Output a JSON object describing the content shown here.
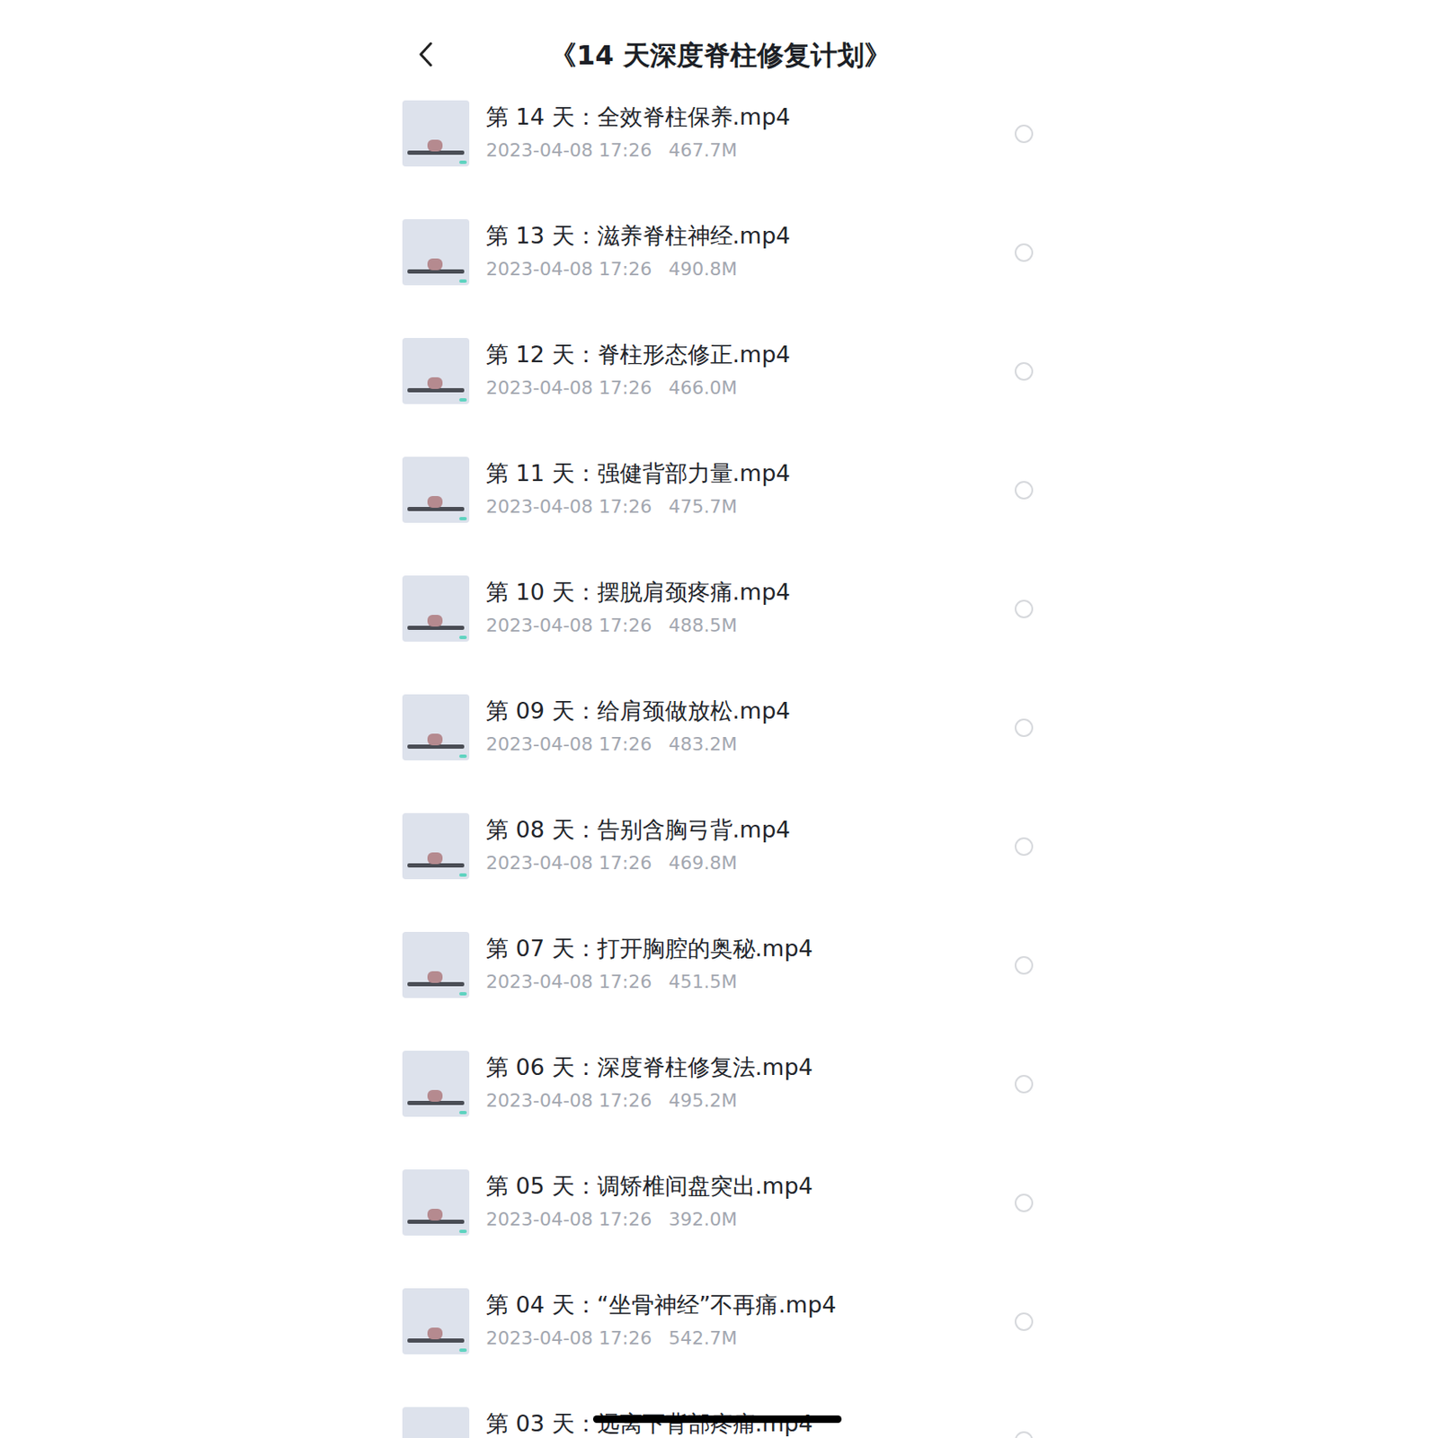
{
  "header": {
    "title": "《14 天深度脊柱修复计划》"
  },
  "files": [
    {
      "title": "第 14 天：全效脊柱保养.mp4",
      "date": "2023-04-08 17:26",
      "size": "467.7M",
      "selected": false
    },
    {
      "title": "第 13 天：滋养脊柱神经.mp4",
      "date": "2023-04-08 17:26",
      "size": "490.8M",
      "selected": false
    },
    {
      "title": "第 12 天：脊柱形态修正.mp4",
      "date": "2023-04-08 17:26",
      "size": "466.0M",
      "selected": false
    },
    {
      "title": "第 11 天：强健背部力量.mp4",
      "date": "2023-04-08 17:26",
      "size": "475.7M",
      "selected": false
    },
    {
      "title": "第 10 天：摆脱肩颈疼痛.mp4",
      "date": "2023-04-08 17:26",
      "size": "488.5M",
      "selected": false
    },
    {
      "title": "第 09 天：给肩颈做放松.mp4",
      "date": "2023-04-08 17:26",
      "size": "483.2M",
      "selected": false
    },
    {
      "title": "第 08 天：告别含胸弓背.mp4",
      "date": "2023-04-08 17:26",
      "size": "469.8M",
      "selected": false
    },
    {
      "title": "第 07 天：打开胸腔的奥秘.mp4",
      "date": "2023-04-08 17:26",
      "size": "451.5M",
      "selected": false
    },
    {
      "title": "第 06 天：深度脊柱修复法.mp4",
      "date": "2023-04-08 17:26",
      "size": "495.2M",
      "selected": false
    },
    {
      "title": "第 05 天：调矫椎间盘突出.mp4",
      "date": "2023-04-08 17:26",
      "size": "392.0M",
      "selected": false
    },
    {
      "title": "第 04 天：“坐骨神经”不再痛.mp4",
      "date": "2023-04-08 17:26",
      "size": "542.7M",
      "selected": false
    },
    {
      "title": "第 03 天：远离下背部疼痛.mp4",
      "date": "",
      "size": "",
      "selected": false
    }
  ]
}
